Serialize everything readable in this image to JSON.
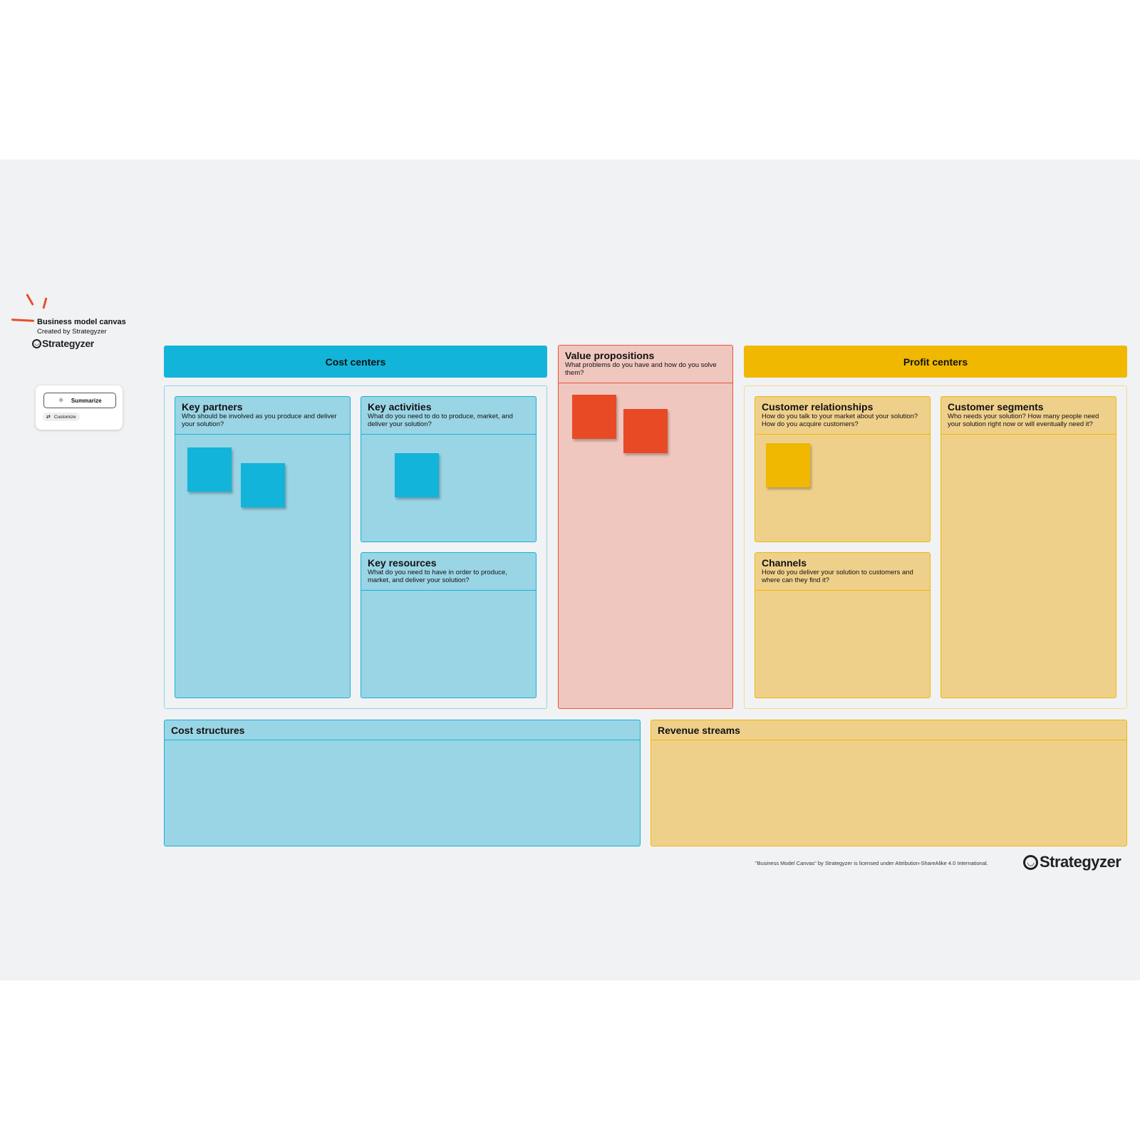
{
  "template": {
    "title": "Business model canvas",
    "subtitle": "Created by Strategyzer",
    "brand": "Strategyzer",
    "brand_mark": "ꟹ"
  },
  "ai_widget": {
    "summarize_label": "Summarize",
    "summarize_icon": "sparkle-icon",
    "customize_label": "Customize",
    "customize_icon": "sliders-icon"
  },
  "sections": {
    "cost_centers": {
      "label": "Cost centers",
      "color": "#12b4d9"
    },
    "profit_centers": {
      "label": "Profit centers",
      "color": "#f0b800"
    }
  },
  "blocks": {
    "key_partners": {
      "title": "Key partners",
      "desc": "Who should be involved as you produce and deliver your solution?",
      "sticky_notes": 2
    },
    "key_activities": {
      "title": "Key activities",
      "desc": "What do you need to do to produce, market, and deliver your solution?",
      "sticky_notes": 1
    },
    "key_resources": {
      "title": "Key resources",
      "desc": "What do you need to have in order to produce, market, and deliver your solution?",
      "sticky_notes": 0
    },
    "value_propositions": {
      "title": "Value propositions",
      "desc": "What problems do you have and how do you solve them?",
      "sticky_notes": 2
    },
    "customer_relationships": {
      "title": "Customer relationships",
      "desc": "How do you talk to your market about your solution? How do you acquire customers?",
      "sticky_notes": 1
    },
    "channels": {
      "title": "Channels",
      "desc": "How do you deliver your solution to customers and where can they find it?",
      "sticky_notes": 0
    },
    "customer_segments": {
      "title": "Customer segments",
      "desc": "Who needs your solution? How many people need your solution right now or will eventually need it?",
      "sticky_notes": 0
    },
    "cost_structures": {
      "title": "Cost structures"
    },
    "revenue_streams": {
      "title": "Revenue streams"
    }
  },
  "colors": {
    "blue_block": "#9ad5e5",
    "red_block": "#f0c7bf",
    "yellow_block": "#efd08b",
    "sticky_blue": "#12b4d9",
    "sticky_red": "#e84a25",
    "sticky_yellow": "#f0b800"
  },
  "footer": {
    "license": "\"Business Model Canvas\" by Strategyzer is licensed under Attribution-ShareAlike 4.0 International.",
    "brand": "Strategyzer"
  }
}
